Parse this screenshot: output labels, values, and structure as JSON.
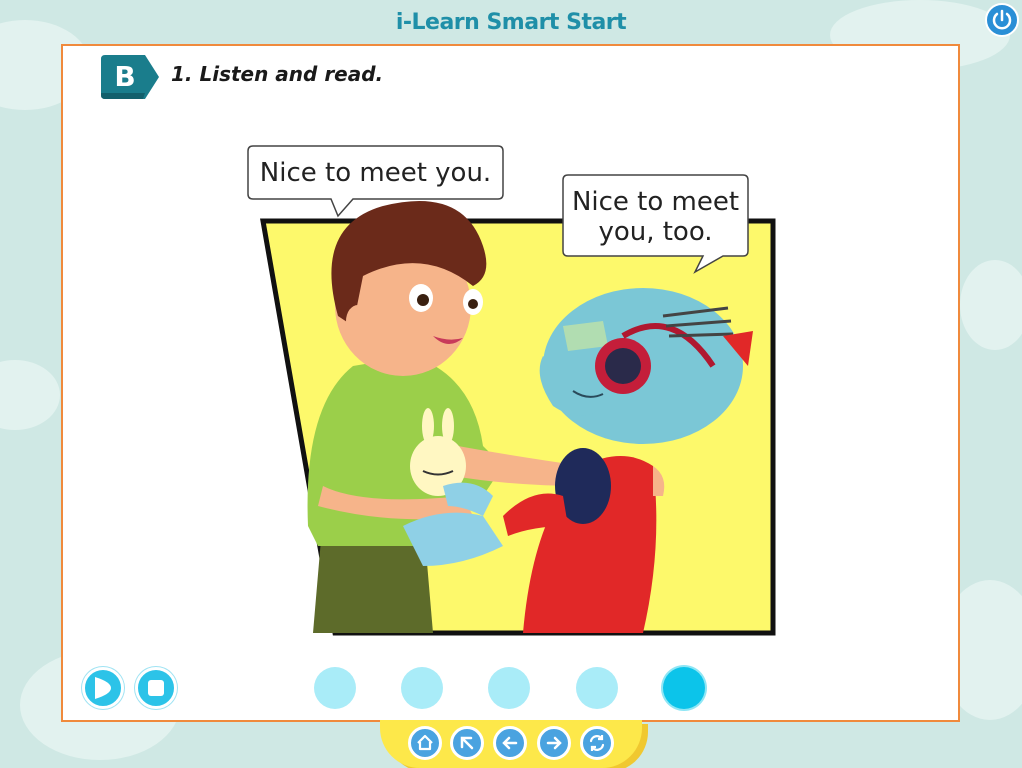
{
  "app": {
    "title": "i-Learn Smart Start"
  },
  "activity": {
    "section_letter": "B",
    "instruction": "1. Listen and read."
  },
  "dialogue": [
    {
      "speaker": "boy",
      "text": "Nice to meet you."
    },
    {
      "speaker": "alien",
      "text_lines": [
        "Nice to meet",
        "you, too."
      ]
    }
  ],
  "controls": {
    "play": "play-icon",
    "stop": "stop-icon",
    "page_dots": 5,
    "active_page": 5
  },
  "nav": [
    "home-icon",
    "back-up-icon",
    "previous-icon",
    "next-icon",
    "refresh-icon"
  ],
  "colors": {
    "title": "#1f8fa8",
    "panel_border": "#f08a3c",
    "badge": "#1a7d8c",
    "scene_bg": "#fdf96b",
    "control": "#2cc3e8",
    "nav_tray": "#fde84a",
    "nav_button": "#4aa3e0"
  }
}
